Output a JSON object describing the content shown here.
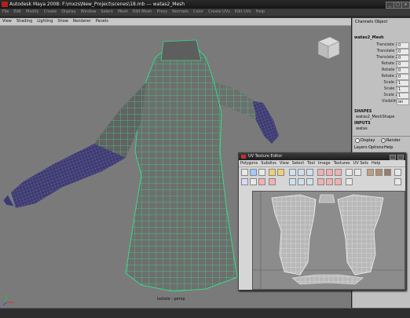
{
  "window": {
    "title": "Autodesk Maya 2008: F:\\mxzs\\New_Project\\scenes\\18.mb   ---   watas2_Mesh",
    "minimize": "_",
    "maximize": "□",
    "close": "x"
  },
  "menubar": [
    "File",
    "Edit",
    "Modify",
    "Create",
    "Display",
    "Window",
    "Select",
    "Mesh",
    "Edit Mesh",
    "Proxy",
    "Normals",
    "Color",
    "Create UVs",
    "Edit UVs",
    "Help"
  ],
  "viewport": {
    "menu": [
      "View",
      "Shading",
      "Lighting",
      "Show",
      "Renderer",
      "Panels"
    ],
    "camera_label": "Isolate : persp"
  },
  "channel_box": {
    "tabs": [
      "Channels",
      "Object"
    ],
    "object_name": "watas2_Mesh",
    "attributes": [
      {
        "label": "Translate X",
        "value": "0"
      },
      {
        "label": "Translate Y",
        "value": "0"
      },
      {
        "label": "Translate Z",
        "value": "0"
      },
      {
        "label": "Rotate X",
        "value": "0"
      },
      {
        "label": "Rotate Y",
        "value": "0"
      },
      {
        "label": "Rotate Z",
        "value": "0"
      },
      {
        "label": "Scale X",
        "value": "1"
      },
      {
        "label": "Scale Y",
        "value": "1"
      },
      {
        "label": "Scale Z",
        "value": "1"
      },
      {
        "label": "Visibility",
        "value": "on"
      }
    ],
    "shapes_header": "SHAPES",
    "shape_name": "watas2_MeshShape",
    "inputs_header": "INPUTS",
    "input_name": "watas"
  },
  "layer_panel": {
    "display_label": "Display",
    "render_label": "Render",
    "menu": [
      "Layers",
      "Options",
      "Help"
    ]
  },
  "uv_editor": {
    "title": "UV Texture Editor",
    "menu": [
      "Polygons",
      "Subdivs",
      "View",
      "Select",
      "Tool",
      "Image",
      "Textures",
      "UV Sets",
      "Help"
    ]
  },
  "colors": {
    "wire": "#39d98a",
    "mesh": "#6e6e6e",
    "glove": "#3c3a6e",
    "uv_lines": "#f2f2f2",
    "uv_bg": "#8c8c8c"
  }
}
